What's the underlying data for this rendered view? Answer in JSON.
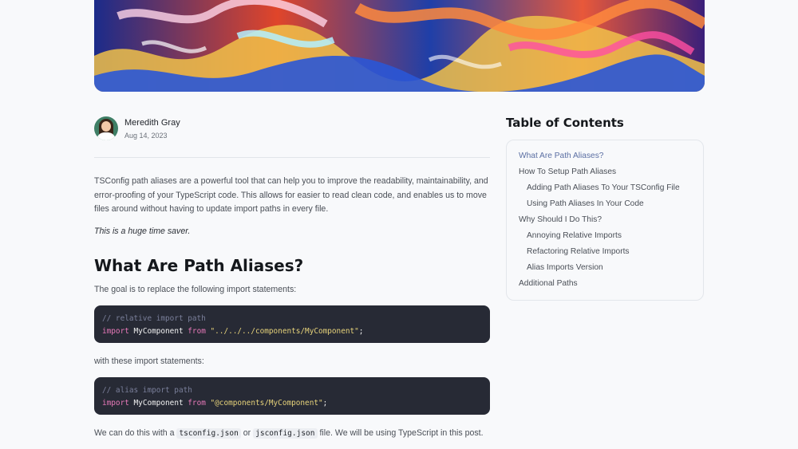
{
  "author": {
    "name": "Meredith Gray",
    "date": "Aug 14, 2023"
  },
  "article": {
    "intro": "TSConfig path aliases are a powerful tool that can help you to improve the readability, maintainability, and error-proofing of your TypeScript code. This allows for easier to read clean code, and enables us to move files around without having to update import paths in every file.",
    "emphasis": "This is a huge time saver.",
    "heading": "What Are Path Aliases?",
    "goal_text": "The goal is to replace the following import statements:",
    "code1": {
      "comment": "// relative import path",
      "kw_import": "import",
      "identifier": "MyComponent",
      "kw_from": "from",
      "path": "\"../../../components/MyComponent\"",
      "end": ";"
    },
    "with_text": "with these import statements:",
    "code2": {
      "comment": "// alias import path",
      "kw_import": "import",
      "identifier": "MyComponent",
      "kw_from": "from",
      "path": "\"@components/MyComponent\"",
      "end": ";"
    },
    "last": {
      "prefix": "We can do this with a",
      "file1": "tsconfig.json",
      "or": "or",
      "file2": "jsconfig.json",
      "suffix": "file. We will be using TypeScript in this post."
    }
  },
  "toc": {
    "title": "Table of Contents",
    "items": [
      {
        "label": "What Are Path Aliases?"
      },
      {
        "label": "How To Setup Path Aliases"
      },
      {
        "label": "Adding Path Aliases To Your TSConfig File"
      },
      {
        "label": "Using Path Aliases In Your Code"
      },
      {
        "label": "Why Should I Do This?"
      },
      {
        "label": "Annoying Relative Imports"
      },
      {
        "label": "Refactoring Relative Imports"
      },
      {
        "label": "Alias Imports Version"
      },
      {
        "label": "Additional Paths"
      }
    ]
  },
  "colors": {
    "background": "#f8f9fb",
    "code_background": "#272a35",
    "keyword": "#e879b9",
    "string": "#e6d27a",
    "toc_active": "#5b6fa3"
  },
  "icons": {
    "avatar": "author-avatar-photo"
  }
}
